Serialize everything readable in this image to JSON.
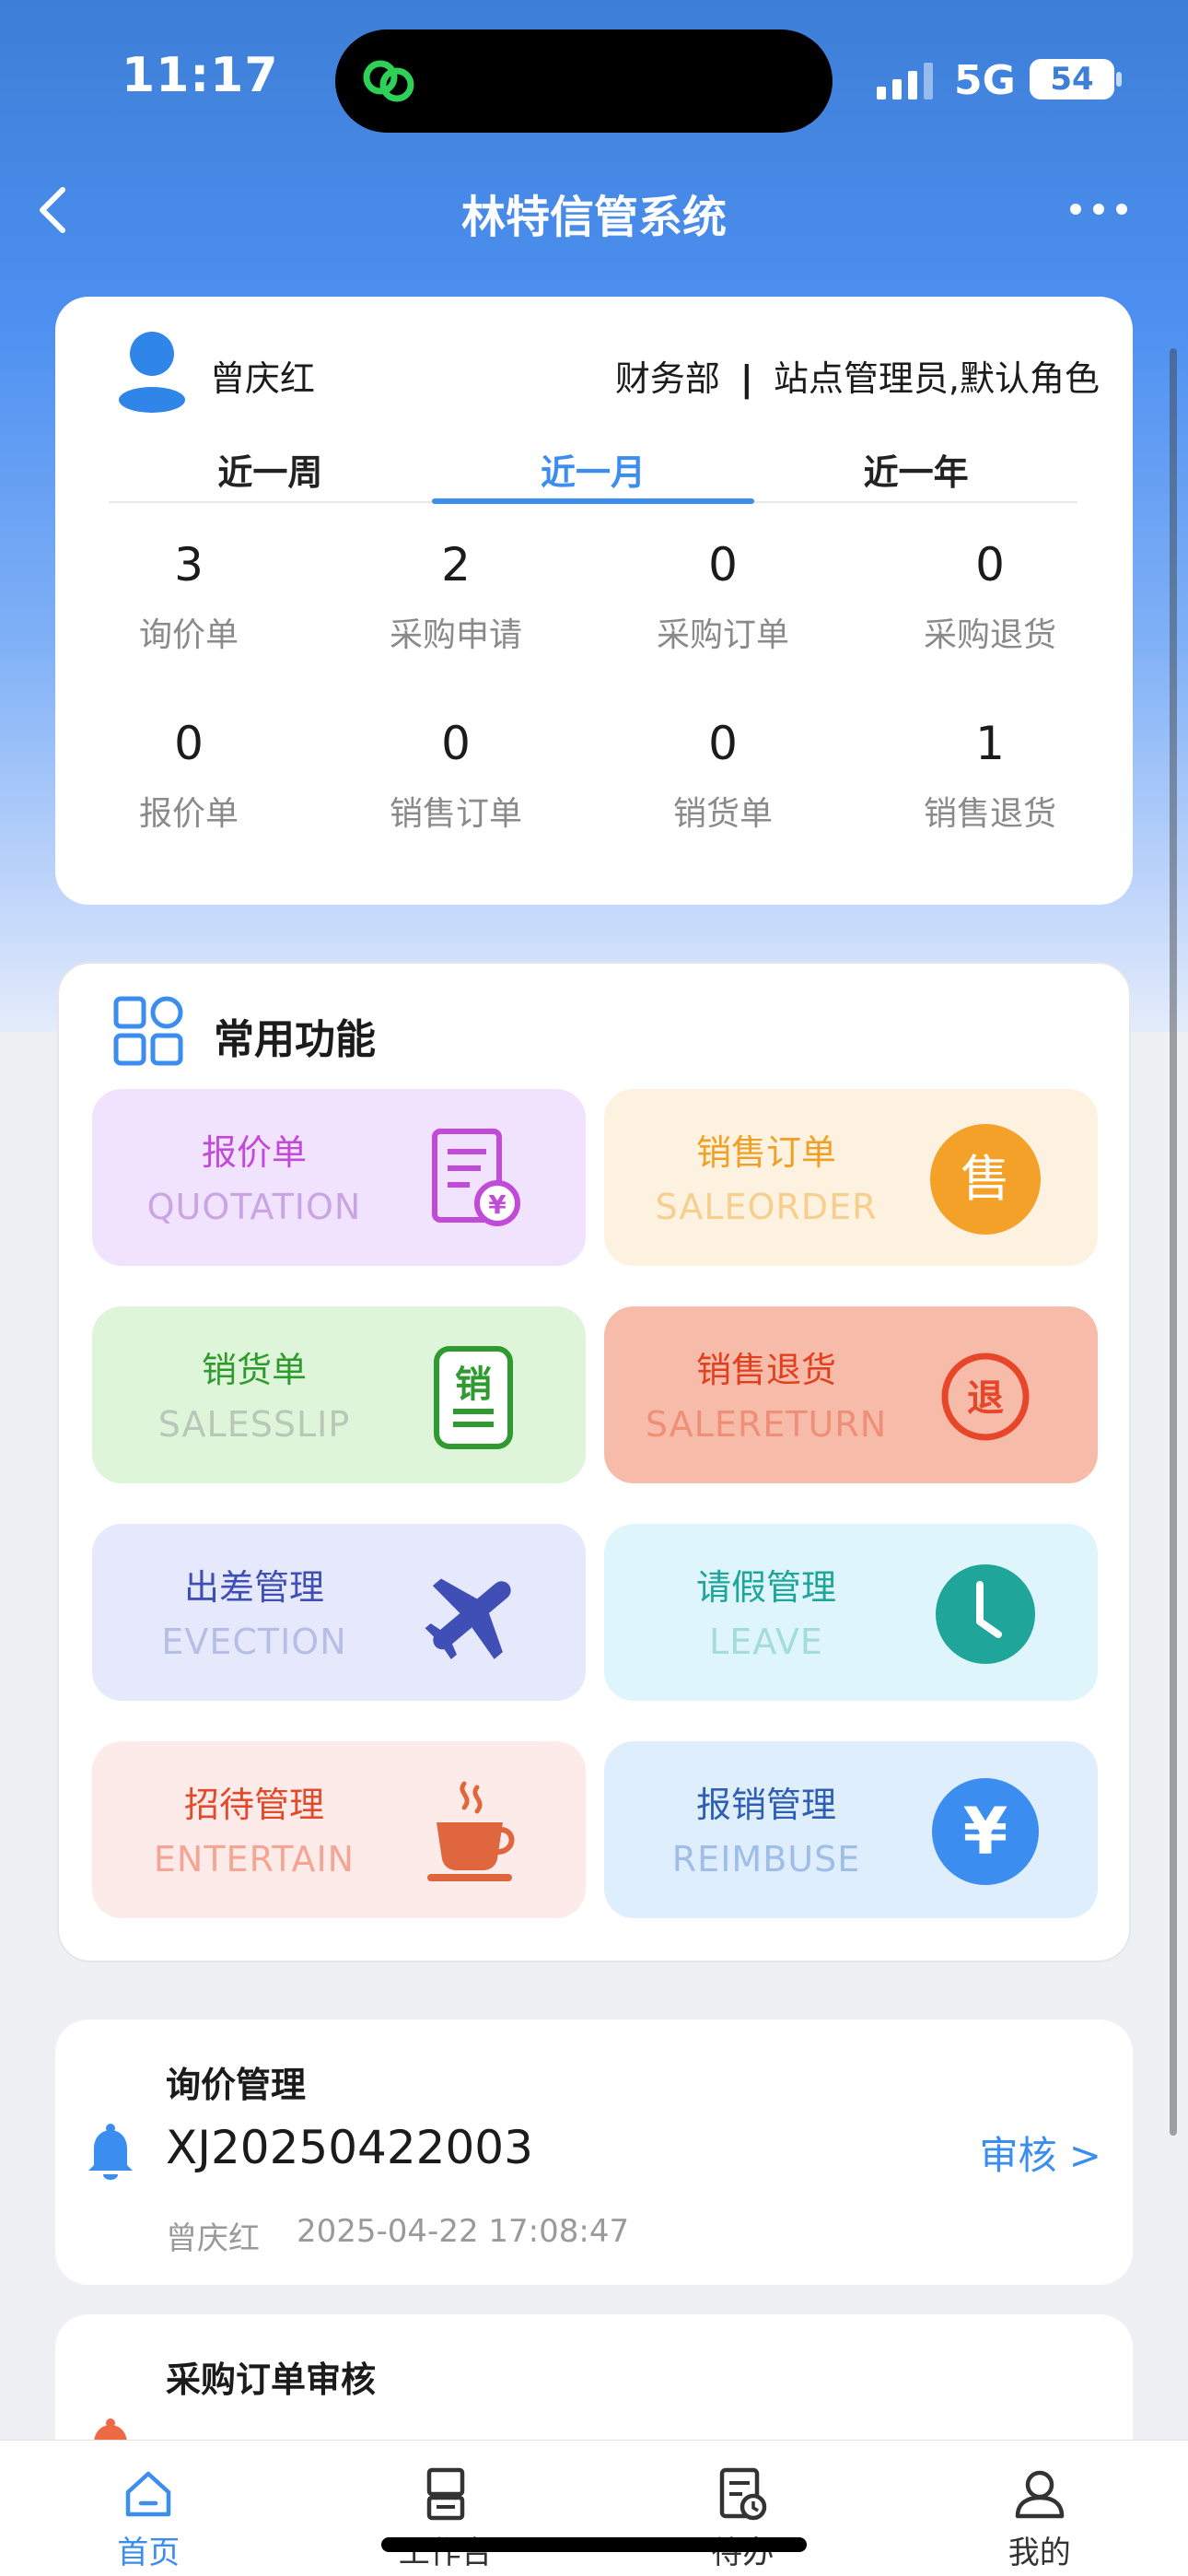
{
  "status_bar": {
    "time": "11:17",
    "network": "5G",
    "battery": "54"
  },
  "nav": {
    "title": "林特信管系统"
  },
  "user": {
    "name": "曾庆红",
    "department": "财务部",
    "role": "站点管理员,默认角色"
  },
  "period_tabs": [
    {
      "label": "近一周",
      "active": false
    },
    {
      "label": "近一月",
      "active": true
    },
    {
      "label": "近一年",
      "active": false
    }
  ],
  "stats": [
    {
      "value": "3",
      "label": "询价单"
    },
    {
      "value": "2",
      "label": "采购申请"
    },
    {
      "value": "0",
      "label": "采购订单"
    },
    {
      "value": "0",
      "label": "采购退货"
    },
    {
      "value": "0",
      "label": "报价单"
    },
    {
      "value": "0",
      "label": "销售订单"
    },
    {
      "value": "0",
      "label": "销货单"
    },
    {
      "value": "1",
      "label": "销售退货"
    }
  ],
  "functions": {
    "title": "常用功能",
    "tiles": [
      {
        "title": "报价单",
        "subtitle": "QUOTATION",
        "icon": "quotation-icon",
        "bg": "#f1e2fd",
        "title_color": "#c24ad8",
        "sub_color": "#c9a6e3",
        "icon_color": "#c24ad8"
      },
      {
        "title": "销售订单",
        "subtitle": "SALEORDER",
        "icon": "sale-order-icon",
        "icon_char": "售",
        "bg": "#fdf2df",
        "title_color": "#f0a026",
        "sub_color": "#f6cf8f",
        "icon_color": "#f4a12a"
      },
      {
        "title": "销货单",
        "subtitle": "SALESSLIP",
        "icon": "sales-slip-icon",
        "icon_char": "销",
        "bg": "#def5da",
        "title_color": "#2f9a2f",
        "sub_color": "#b8c8b8",
        "icon_color": "#2f9a2f"
      },
      {
        "title": "销售退货",
        "subtitle": "SALERETURN",
        "icon": "sale-return-icon",
        "icon_char": "退",
        "bg": "#f6bca9",
        "title_color": "#e0401f",
        "sub_color": "#f08f78",
        "icon_color": "#e8462a"
      },
      {
        "title": "出差管理",
        "subtitle": "EVECTION",
        "icon": "airplane-icon",
        "bg": "#e5e9fb",
        "title_color": "#3f4fb5",
        "sub_color": "#b6bee6",
        "icon_color": "#3f4fb5"
      },
      {
        "title": "请假管理",
        "subtitle": "LEAVE",
        "icon": "clock-icon",
        "bg": "#def5fb",
        "title_color": "#1fa59a",
        "sub_color": "#a4dcd6",
        "icon_color": "#1fa59a"
      },
      {
        "title": "招待管理",
        "subtitle": "ENTERTAIN",
        "icon": "coffee-icon",
        "bg": "#fdebea",
        "title_color": "#e24a2a",
        "sub_color": "#f4a594",
        "icon_color": "#e0663d"
      },
      {
        "title": "报销管理",
        "subtitle": "REIMBUSE",
        "icon": "yen-icon",
        "icon_char": "¥",
        "bg": "#dfeefc",
        "title_color": "#2f5fb5",
        "sub_color": "#9fbde6",
        "icon_color": "#3b8ef0"
      }
    ]
  },
  "notices": [
    {
      "heading": "询价管理",
      "number": "XJ20250422003",
      "action": "审核 >",
      "user": "曾庆红",
      "time": "2025-04-22 17:08:47"
    },
    {
      "heading": "采购订单审核"
    }
  ],
  "tabbar": [
    {
      "label": "首页",
      "icon": "home-icon",
      "active": true
    },
    {
      "label": "工作台",
      "icon": "workbench-icon",
      "active": false
    },
    {
      "label": "待办",
      "icon": "todo-icon",
      "active": false
    },
    {
      "label": "我的",
      "icon": "profile-icon",
      "active": false
    }
  ],
  "colors": {
    "accent": "#3b8ef0",
    "header": "#3d7fd6"
  }
}
